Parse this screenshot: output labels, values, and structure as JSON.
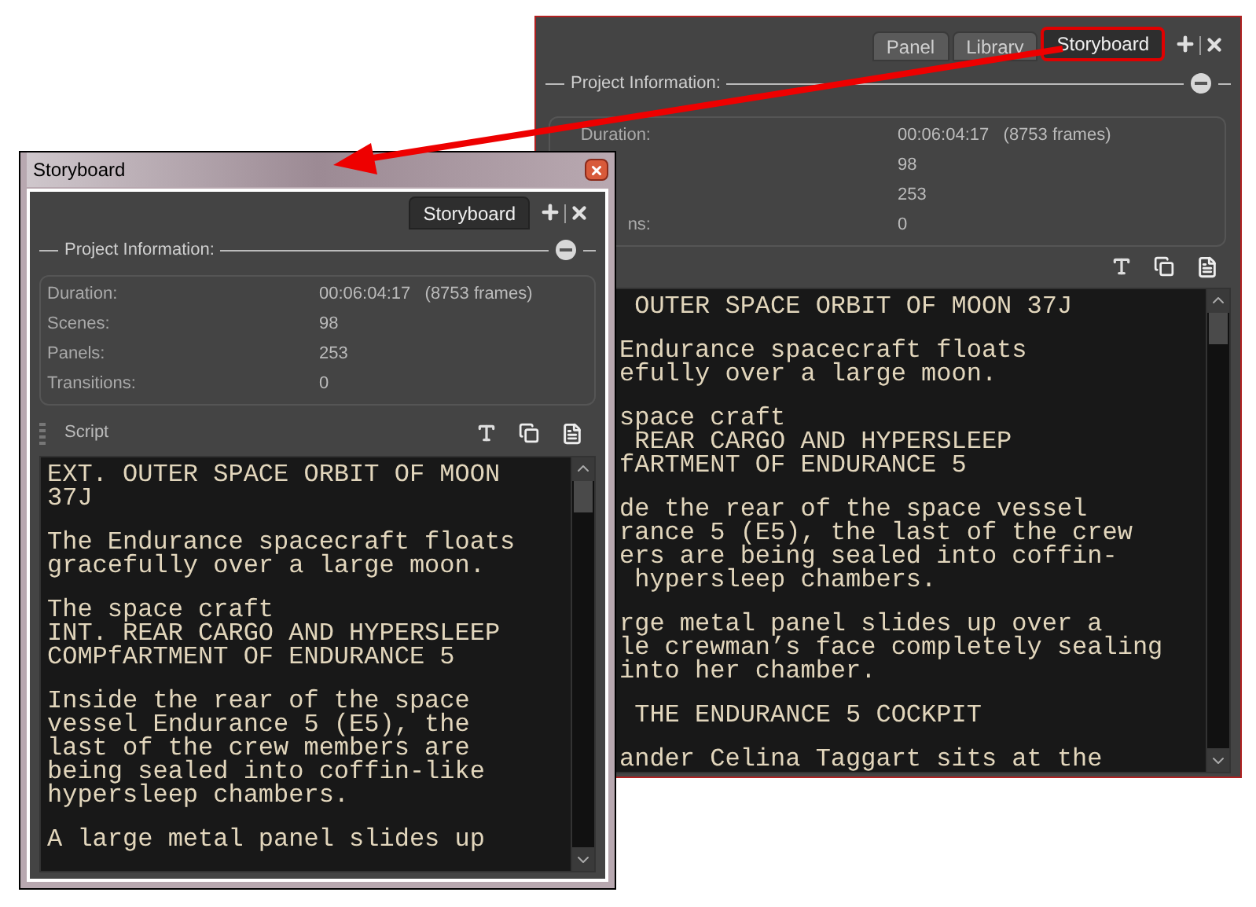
{
  "back_panel": {
    "tabs": [
      {
        "label": "Panel",
        "selected": false
      },
      {
        "label": "Library",
        "selected": false
      },
      {
        "label": "Storyboard",
        "selected": true
      }
    ],
    "section_title": "Project Information:",
    "info_rows": [
      {
        "label": "Duration:",
        "value": "00:06:04:17   (8753 frames)"
      },
      {
        "value": "98"
      },
      {
        "value": "253"
      },
      {
        "label": "ns:",
        "value": "0"
      }
    ],
    "script_paragraphs": [
      [
        " OUTER SPACE ORBIT OF MOON 37J"
      ],
      [
        "Endurance spacecraft floats",
        "efully over a large moon."
      ],
      [
        "space craft",
        " REAR CARGO AND HYPERSLEEP",
        "fARTMENT OF ENDURANCE 5"
      ],
      [
        "de the rear of the space vessel",
        "rance 5 (E5), the last of the crew",
        "ers are being sealed into coffin-",
        " hypersleep chambers."
      ],
      [
        "rge metal panel slides up over a",
        "le crewman’s face completely sealing",
        "into her chamber."
      ],
      [
        " THE ENDURANCE 5 COCKPIT"
      ],
      [
        "ander Celina Taggart sits at the"
      ]
    ]
  },
  "floating_window": {
    "title": "Storyboard",
    "tabs": [
      {
        "label": "Storyboard",
        "selected": true
      }
    ],
    "section_title": "Project Information:",
    "info_rows": [
      {
        "label": "Duration:",
        "value": "00:06:04:17   (8753 frames)"
      },
      {
        "label": "Scenes:",
        "value": "98"
      },
      {
        "label": "Panels:",
        "value": "253"
      },
      {
        "label": "Transitions:",
        "value": "0"
      }
    ],
    "script_label": "Script",
    "script_paragraphs": [
      [
        "EXT. OUTER SPACE ORBIT OF MOON",
        "37J"
      ],
      [
        "The Endurance spacecraft floats",
        "gracefully over a large moon."
      ],
      [
        "The space craft",
        "INT. REAR CARGO AND HYPERSLEEP",
        "COMPfARTMENT OF ENDURANCE 5"
      ],
      [
        "Inside the rear of the space",
        "vessel Endurance 5 (E5), the",
        "last of the crew members are",
        "being sealed into coffin-like",
        "hypersleep chambers."
      ],
      [
        "A large metal panel slides up"
      ]
    ]
  }
}
